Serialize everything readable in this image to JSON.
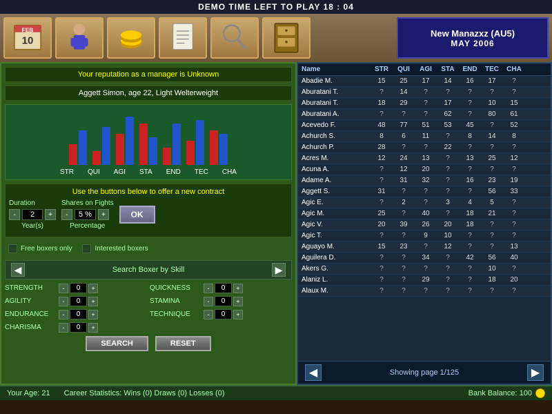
{
  "topBar": {
    "text": "DEMO TIME LEFT TO PLAY 18 : 04"
  },
  "managerBox": {
    "name": "New Manazxz (AU5)",
    "date": "MAY 2006"
  },
  "reputation": {
    "text": "Your reputation as a manager is    Unknown"
  },
  "boxer": {
    "info": "Aggett Simon, age 22, Light Welterweight"
  },
  "contract": {
    "title": "Use the buttons below to offer a new contract",
    "durationLabel": "Duration",
    "durationValue": "2",
    "durationUnit": "Year(s)",
    "sharesLabel": "Shares on Fights",
    "sharesValue": "5 %",
    "sharesUnit": "Percentage",
    "okLabel": "OK"
  },
  "checkboxes": {
    "freeBoxers": "Free boxers only",
    "interestedBoxers": "Interested boxers"
  },
  "search": {
    "title": "Search Boxer by Skill",
    "fields": [
      {
        "label": "STRENGTH",
        "value": "0"
      },
      {
        "label": "QUICKNESS",
        "value": "0"
      },
      {
        "label": "AGILITY",
        "value": "0"
      },
      {
        "label": "STAMINA",
        "value": "0"
      },
      {
        "label": "ENDURANCE",
        "value": "0"
      },
      {
        "label": "TECHNIQUE",
        "value": "0"
      },
      {
        "label": "CHARISMA",
        "value": "0"
      }
    ],
    "searchBtn": "SEARCH",
    "resetBtn": "RESET"
  },
  "chart": {
    "labels": [
      "STR",
      "QUI",
      "AGI",
      "STA",
      "END",
      "TEC",
      "CHA"
    ],
    "redBars": [
      30,
      20,
      45,
      60,
      25,
      35,
      50
    ],
    "blueBars": [
      50,
      55,
      70,
      40,
      60,
      65,
      45
    ]
  },
  "boxerTable": {
    "headers": [
      "Name",
      "STR",
      "QUI",
      "AGI",
      "STA",
      "END",
      "TEC",
      "CHA"
    ],
    "rows": [
      [
        "Abadie M.",
        "15",
        "25",
        "17",
        "14",
        "16",
        "17",
        "?"
      ],
      [
        "Aburatani T.",
        "?",
        "14",
        "?",
        "?",
        "?",
        "?",
        "?"
      ],
      [
        "Aburatani T.",
        "18",
        "29",
        "?",
        "17",
        "?",
        "10",
        "15"
      ],
      [
        "Aburatani A.",
        "?",
        "?",
        "?",
        "62",
        "?",
        "80",
        "61"
      ],
      [
        "Acevedo F.",
        "48",
        "77",
        "51",
        "53",
        "45",
        "?",
        "52"
      ],
      [
        "Achurch S.",
        "8",
        "6",
        "11",
        "?",
        "8",
        "14",
        "8"
      ],
      [
        "Achurch P.",
        "28",
        "?",
        "?",
        "22",
        "?",
        "?",
        "?"
      ],
      [
        "Acres M.",
        "12",
        "24",
        "13",
        "?",
        "13",
        "25",
        "12"
      ],
      [
        "Acuna A.",
        "?",
        "12",
        "20",
        "?",
        "?",
        "?",
        "?"
      ],
      [
        "Adame A.",
        "?",
        "31",
        "32",
        "?",
        "16",
        "23",
        "19"
      ],
      [
        "Aggett S.",
        "31",
        "?",
        "?",
        "?",
        "?",
        "56",
        "33"
      ],
      [
        "Agic E.",
        "?",
        "2",
        "?",
        "3",
        "4",
        "5",
        "?"
      ],
      [
        "Agic M.",
        "25",
        "?",
        "40",
        "?",
        "18",
        "21",
        "?"
      ],
      [
        "Agic V.",
        "20",
        "39",
        "26",
        "20",
        "18",
        "?",
        "?"
      ],
      [
        "Agic T.",
        "?",
        "?",
        "9",
        "10",
        "?",
        "?",
        "?"
      ],
      [
        "Aguayo M.",
        "15",
        "23",
        "?",
        "12",
        "?",
        "?",
        "13"
      ],
      [
        "Aguilera D.",
        "?",
        "?",
        "34",
        "?",
        "42",
        "56",
        "40"
      ],
      [
        "Akers G.",
        "?",
        "?",
        "?",
        "?",
        "?",
        "10",
        "?"
      ],
      [
        "Alaniz L.",
        "?",
        "?",
        "29",
        "?",
        "?",
        "18",
        "20"
      ],
      [
        "Alaux M.",
        "?",
        "?",
        "?",
        "?",
        "?",
        "?",
        "?"
      ]
    ]
  },
  "pagination": {
    "text": "Showing page 1/125"
  },
  "statusBar": {
    "age": "Your Age: 21",
    "careerStats": "Career Statistics: Wins (0) Draws (0) Losses (0)",
    "bankBalance": "Bank Balance: 100"
  }
}
